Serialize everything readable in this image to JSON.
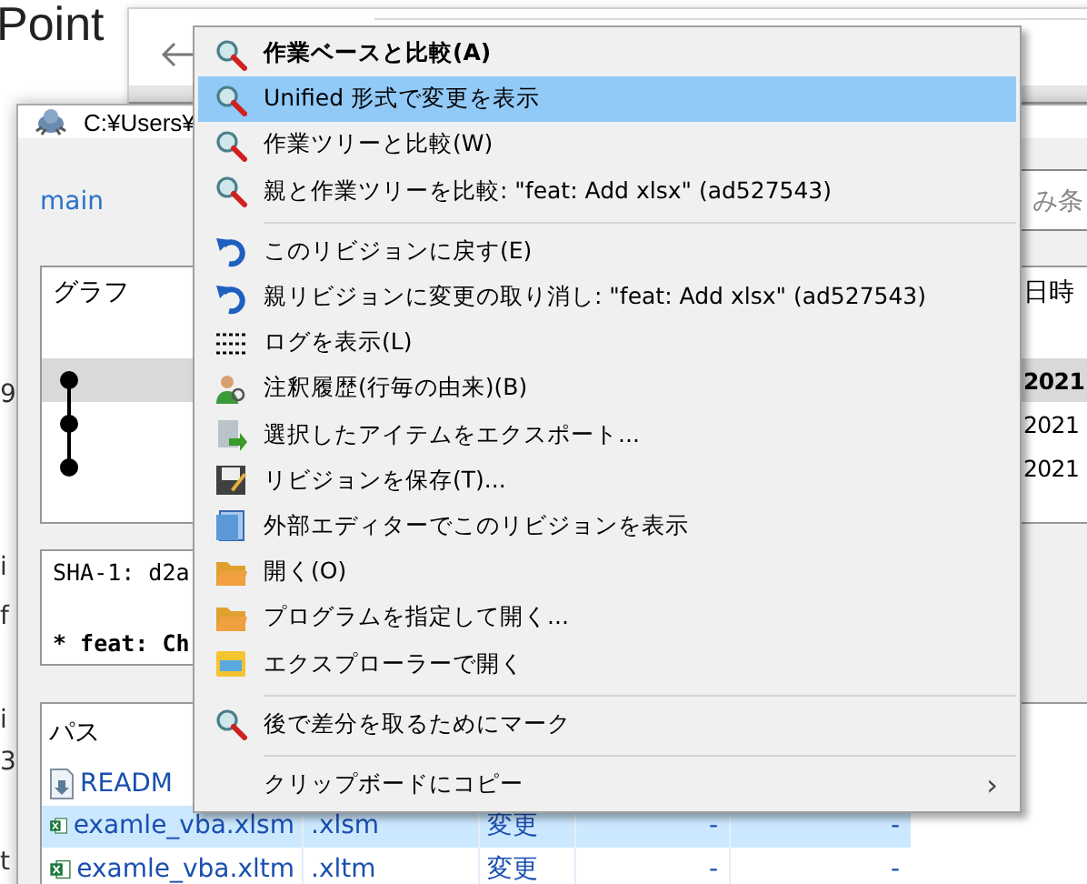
{
  "background_page": {
    "heading": "Point",
    "fragments": [
      "9",
      "i",
      "f",
      "i",
      "3",
      "t"
    ]
  },
  "log_window": {
    "title": "C:¥Users¥",
    "branch": "main",
    "filter": {
      "placeholder": "み条"
    },
    "graph": {
      "columns": [
        "グラフ",
        "日時"
      ],
      "rows": [
        {
          "date": "2021",
          "selected": true
        },
        {
          "date": "2021",
          "selected": false
        },
        {
          "date": "2021",
          "selected": false
        }
      ]
    },
    "commit_message": {
      "sha": "SHA-1: d2a",
      "summary": "* feat: Ch"
    },
    "files": {
      "columns": [
        "パス"
      ],
      "rows": [
        {
          "path": "READM",
          "extension": "",
          "status": "",
          "col_4": "",
          "col_5": "",
          "selected": false
        },
        {
          "path": "examle_vba.xlsm",
          "extension": ".xlsm",
          "status": "変更",
          "col_4": "-",
          "col_5": "-",
          "selected": true
        },
        {
          "path": "examle_vba.xltm",
          "extension": ".xltm",
          "status": "変更",
          "col_4": "-",
          "col_5": "-",
          "selected": false
        }
      ]
    }
  },
  "context_menu": {
    "items": [
      {
        "kind": "item",
        "label": "作業ベースと比較(A)",
        "default": true,
        "selected": false
      },
      {
        "kind": "item",
        "label": "Unified 形式で変更を表示",
        "default": false,
        "selected": true
      },
      {
        "kind": "item",
        "label": "作業ツリーと比較(W)",
        "default": false,
        "selected": false
      },
      {
        "kind": "item",
        "label": "親と作業ツリーを比較: \"feat: Add xlsx\" (ad527543)",
        "default": false,
        "selected": false
      },
      {
        "kind": "separator"
      },
      {
        "kind": "item",
        "label": "このリビジョンに戻す(E)",
        "default": false,
        "selected": false
      },
      {
        "kind": "item",
        "label": "親リビジョンに変更の取り消し: \"feat: Add xlsx\" (ad527543)",
        "default": false,
        "selected": false
      },
      {
        "kind": "item",
        "label": "ログを表示(L)",
        "default": false,
        "selected": false
      },
      {
        "kind": "item",
        "label": "注釈履歴(行毎の由来)(B)",
        "default": false,
        "selected": false
      },
      {
        "kind": "item",
        "label": "選択したアイテムをエクスポート...",
        "default": false,
        "selected": false
      },
      {
        "kind": "item",
        "label": "リビジョンを保存(T)...",
        "default": false,
        "selected": false
      },
      {
        "kind": "item",
        "label": "外部エディターでこのリビジョンを表示",
        "default": false,
        "selected": false
      },
      {
        "kind": "item",
        "label": "開く(O)",
        "default": false,
        "selected": false
      },
      {
        "kind": "item",
        "label": "プログラムを指定して開く...",
        "default": false,
        "selected": false
      },
      {
        "kind": "item",
        "label": "エクスプローラーで開く",
        "default": false,
        "selected": false
      },
      {
        "kind": "separator"
      },
      {
        "kind": "item",
        "label": "後で差分を取るためにマーク",
        "default": false,
        "selected": false
      },
      {
        "kind": "separator"
      },
      {
        "kind": "item",
        "label": "クリップボードにコピー",
        "submenu_arrow": "›",
        "default": false,
        "selected": false
      }
    ]
  }
}
